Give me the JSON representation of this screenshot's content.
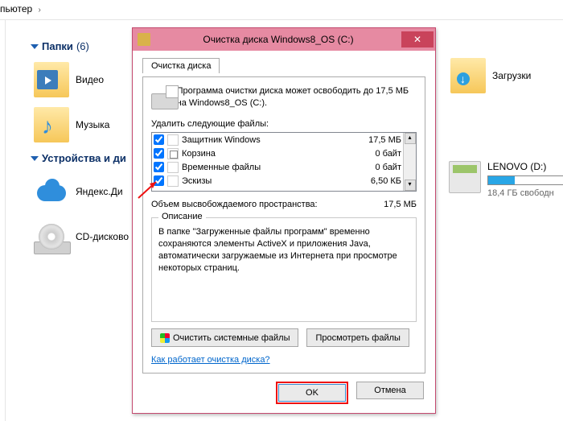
{
  "breadcrumb": {
    "item": "пьютер",
    "sep": "›"
  },
  "groups": {
    "folders": {
      "title": "Папки",
      "count": "(6)"
    },
    "devices": {
      "title": "Устройства и ди"
    }
  },
  "items": {
    "video": "Видео",
    "music": "Музыка",
    "yadisk": "Яндекс.Ди",
    "cddrive": "CD-дисково",
    "downloads": "Загрузки"
  },
  "drive": {
    "name": "LENOVO (D:)",
    "free": "18,4 ГБ свободн",
    "fillPct": "28%"
  },
  "dialog": {
    "title": "Очистка диска Windows8_OS (C:)",
    "tab": "Очистка диска",
    "intro": "Программа очистки диска может освободить до 17,5 МБ на Windows8_OS (C:).",
    "listLabel": "Удалить следующие файлы:",
    "files": [
      {
        "name": "Защитник Windows",
        "size": "17,5 МБ",
        "checked": true
      },
      {
        "name": "Корзина",
        "size": "0 байт",
        "checked": true
      },
      {
        "name": "Временные файлы",
        "size": "0 байт",
        "checked": true
      },
      {
        "name": "Эскизы",
        "size": "6,50 КБ",
        "checked": true
      }
    ],
    "totalLabel": "Объем высвобождаемого пространства:",
    "totalValue": "17,5 МБ",
    "descTitle": "Описание",
    "descText": "В папке \"Загруженные файлы программ\" временно сохраняются элементы ActiveX и приложения Java, автоматически загружаемые из Интернета при просмотре некоторых страниц.",
    "btnCleanSys": "Очистить системные файлы",
    "btnView": "Просмотреть файлы",
    "link": "Как работает очистка диска?",
    "ok": "OK",
    "cancel": "Отмена"
  }
}
